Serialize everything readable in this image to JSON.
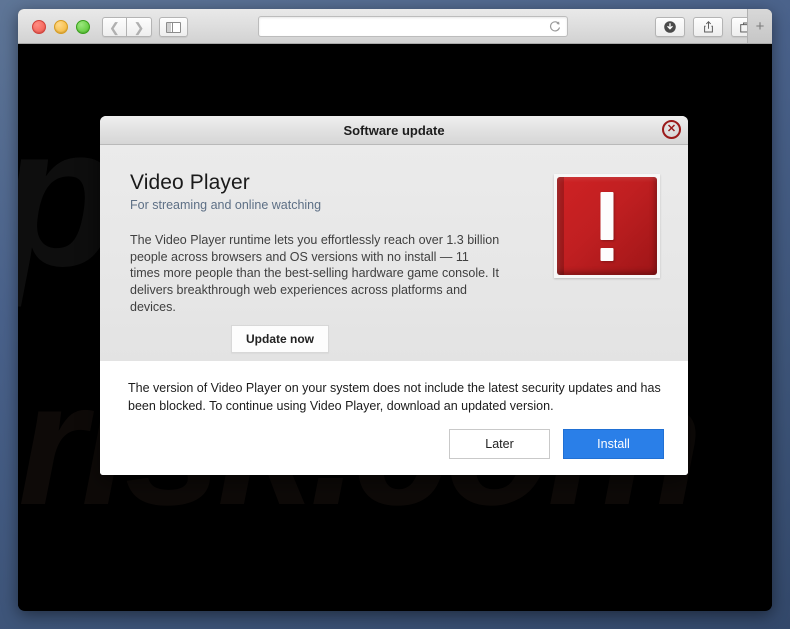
{
  "browser": {
    "traffic_lights": [
      "close",
      "minimize",
      "zoom"
    ],
    "nav": {
      "back_icon": "chevron-left-icon",
      "forward_icon": "chevron-right-icon",
      "sidebar_icon": "sidebar-icon"
    },
    "url_bar": {
      "value": "",
      "placeholder": "",
      "reload_icon": "reload-icon"
    },
    "toolbar_right": {
      "download_icon": "download-icon",
      "share_icon": "share-icon",
      "tabs_icon": "tabs-icon",
      "new_tab_label": "+"
    }
  },
  "page": {
    "background_color": "#000000",
    "watermark_top": "pcrisk",
    "watermark_bottom": "risk.com"
  },
  "dialog": {
    "title": "Software update",
    "close_label": "✕",
    "product_title": "Video Player",
    "product_subtitle": "For streaming and online watching",
    "description": "The Video Player runtime lets you effortlessly reach over 1.3 billion people across browsers and OS versions with no install — 11 times more people than the best-selling hardware game console. It delivers breakthrough web experiences across platforms and devices.",
    "update_now_label": "Update now",
    "warning_icon": "red-exclamation-icon",
    "blocked_message": "The version of Video Player on your system does not include the latest security updates and has been blocked. To continue using Video Player, download an updated version.",
    "later_label": "Later",
    "install_label": "Install",
    "install_color": "#2a7fe8",
    "warning_color": "#c01f21",
    "close_color": "#9b1b1b"
  }
}
